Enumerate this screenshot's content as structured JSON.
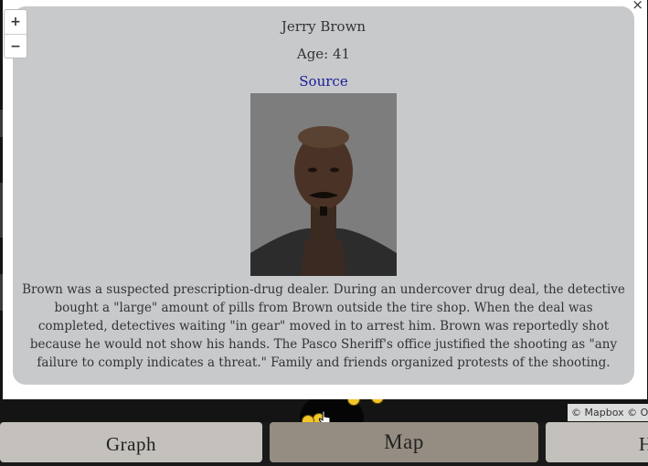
{
  "popup": {
    "close_label": "×",
    "name": "Jerry Brown",
    "age": "Age: 41",
    "source_label": "Source",
    "description": "Brown was a suspected prescription-drug dealer. During an undercover drug deal, the detective bought a \"large\" amount of pills from Brown outside the tire shop. When the deal was completed, detectives waiting \"in gear\" moved in to arrest him. Brown was reportedly shot because he would not show his hands. The Pasco Sheriff's office justified the shooting as \"any failure to comply indicates a threat.\" Family and friends organized protests of the shooting."
  },
  "map": {
    "zoom_in_label": "+",
    "zoom_out_label": "−",
    "attribution": "© Mapbox © O"
  },
  "tabs": [
    {
      "label": "Graph"
    },
    {
      "label": "Map",
      "active": true
    },
    {
      "label": "H"
    }
  ],
  "colors": {
    "popup_bg": "#c7c9cb",
    "active_tab": "#958d82",
    "inactive_tab": "#c4c1bc",
    "marker": "#f2c52a",
    "link": "#1a1a9a"
  }
}
